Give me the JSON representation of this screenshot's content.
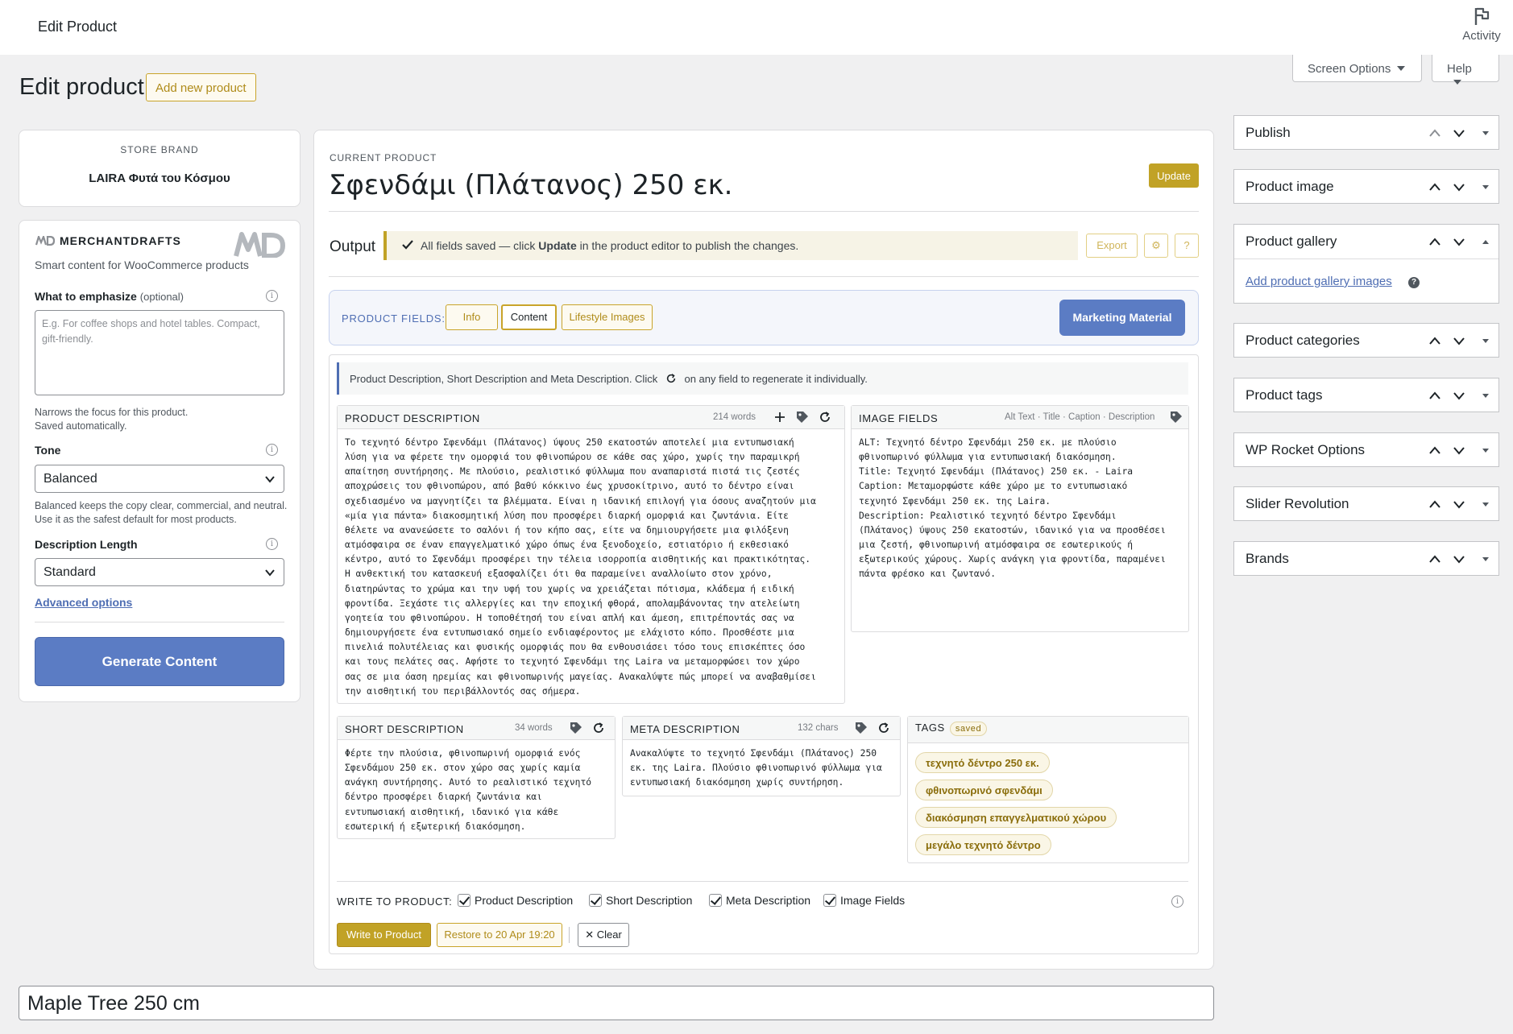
{
  "topbar": {
    "title": "Edit Product",
    "activity_label": "Activity"
  },
  "screen_options": {
    "screen_label": "Screen Options",
    "help_label": "Help"
  },
  "page": {
    "heading": "Edit product",
    "add_new_label": "Add new product"
  },
  "brand": {
    "label": "STORE BRAND",
    "name": "LAIRA Φυτά του Κόσμου"
  },
  "generator": {
    "logo_text": "MERCHANTDRAFTS",
    "subtitle": "Smart content for WooCommerce products",
    "emphasize_label": "What to emphasize",
    "emphasize_optional": "(optional)",
    "emphasize_placeholder": "E.g. For coffee shops and hotel tables. Compact, gift-friendly.",
    "emphasize_hint_1": "Narrows the focus for this product.",
    "emphasize_hint_2": "Saved automatically.",
    "tone_label": "Tone",
    "tone_value": "Balanced",
    "tone_hint": "Balanced keeps the copy clear, commercial, and neutral. Use it as the safest default for most products.",
    "length_label": "Description Length",
    "length_value": "Standard",
    "advanced_label": "Advanced options",
    "generate_label": "Generate Content",
    "brand_color": "#5b7cc4"
  },
  "main": {
    "current_label": "CURRENT PRODUCT",
    "product_title": "Σφενδάμι (Πλάτανος) 250 εκ.",
    "update_label": "Update",
    "output_label": "Output",
    "notice_pre": "All fields saved — click",
    "notice_bold": "Update",
    "notice_post": "in the product editor to publish the changes.",
    "export_label": "Export",
    "settings_icon_label": "⚙",
    "help_btn_label": "?",
    "fields_label": "PRODUCT FIELDS:",
    "tabs": [
      {
        "label": "Info"
      },
      {
        "label": "Content"
      },
      {
        "label": "Lifestyle Images"
      }
    ],
    "marketing_label": "Marketing Material",
    "intro_pre": "Product Description, Short Description and Meta Description. Click",
    "intro_post": "on any field to regenerate it individually.",
    "accent_color": "#c1a226"
  },
  "product_description": {
    "title": "PRODUCT DESCRIPTION",
    "words": "214 words",
    "text": "Το τεχνητό δέντρο Σφενδάμι (Πλάτανος) ύψους 250 εκατοστών αποτελεί μια εντυπωσιακή\nλύση για να φέρετε την ομορφιά του φθινοπώρου σε κάθε σας χώρο, χωρίς την παραμικρή\nαπαίτηση συντήρησης. Με πλούσιο, ρεαλιστικό φύλλωμα που αναπαριστά πιστά τις ζεστές\nαποχρώσεις του φθινοπώρου, από βαθύ κόκκινο έως χρυσοκίτρινο, αυτό το δέντρο είναι\nσχεδιασμένο να μαγνητίζει τα βλέμματα. Είναι η ιδανική επιλογή για όσους αναζητούν μια\n«μία για πάντα» διακοσμητική λύση που προσφέρει διαρκή ομορφιά και ζωντάνια. Είτε\nθέλετε να ανανεώσετε το σαλόνι ή τον κήπο σας, είτε να δημιουργήσετε μια φιλόξενη\nατμόσφαιρα σε έναν επαγγελματικό χώρο όπως ένα ξενοδοχείο, εστιατόριο ή εκθεσιακό\nκέντρο, αυτό το Σφενδάμι προσφέρει την τέλεια ισορροπία αισθητικής και πρακτικότητας.\nΗ ανθεκτική του κατασκευή εξασφαλίζει ότι θα παραμείνει αναλλοίωτο στον χρόνο,\nδιατηρώντας το χρώμα και την υφή του χωρίς να χρειάζεται πότισμα, κλάδεμα ή ειδική\nφροντίδα. Ξεχάστε τις αλλεργίες και την εποχική φθορά, απολαμβάνοντας την ατελείωτη\nγοητεία του φθινοπώρου. Η τοποθέτησή του είναι απλή και άμεση, επιτρέποντάς σας να\nδημιουργήσετε ένα εντυπωσιακό σημείο ενδιαφέροντος με ελάχιστο κόπο. Προσθέστε μια\nπινελιά πολυτέλειας και φυσικής ομορφιάς που θα ενθουσιάσει τόσο τους επισκέπτες όσο\nκαι τους πελάτες σας. Αφήστε το τεχνητό Σφενδάμι της Laira να μεταμορφώσει τον χώρο\nσας σε μια όαση ηρεμίας και φθινοπωρινής μαγείας. Ανακαλύψτε πώς μπορεί να αναβαθμίσει\nτην αισθητική του περιβάλλοντός σας σήμερα."
  },
  "image_fields": {
    "title": "IMAGE FIELDS",
    "meta": "Alt Text · Title · Caption · Description",
    "text": "ALT: Τεχνητό δέντρο Σφενδάμι 250 εκ. με πλούσιο\nφθινοπωρινό φύλλωμα για εντυπωσιακή διακόσμηση.\nTitle: Τεχνητό Σφενδάμι (Πλάτανος) 250 εκ. - Laira\nCaption: Μεταμορφώστε κάθε χώρο με το εντυπωσιακό\nτεχνητό Σφενδάμι 250 εκ. της Laira.\nDescription: Ρεαλιστικό τεχνητό δέντρο Σφενδάμι\n(Πλάτανος) ύψους 250 εκατοστών, ιδανικό για να προσθέσει\nμια ζεστή, φθινοπωρινή ατμόσφαιρα σε εσωτερικούς ή\nεξωτερικούς χώρους. Χωρίς ανάγκη για φροντίδα, παραμένει\nπάντα φρέσκο και ζωντανό."
  },
  "short_description": {
    "title": "SHORT DESCRIPTION",
    "words": "34 words",
    "text": "Φέρτε την πλούσια, φθινοπωρινή ομορφιά ενός\nΣφενδάμου 250 εκ. στον χώρο σας χωρίς καμία\nανάγκη συντήρησης. Αυτό το ρεαλιστικό τεχνητό\nδέντρο προσφέρει διαρκή ζωντάνια και\nεντυπωσιακή αισθητική, ιδανικό για κάθε\nεσωτερική ή εξωτερική διακόσμηση."
  },
  "meta_description": {
    "title": "META DESCRIPTION",
    "chars": "132 chars",
    "text": "Ανακαλύψτε το τεχνητό Σφενδάμι (Πλάτανος) 250\nεκ. της Laira. Πλούσιο φθινοπωρινό φύλλωμα για\nεντυπωσιακή διακόσμηση χωρίς συντήρηση."
  },
  "tags": {
    "title": "TAGS",
    "badge": "saved",
    "items": [
      "τεχνητό δέντρο 250 εκ.",
      "φθινοπωρινό σφενδάμι",
      "διακόσμηση επαγγελματικού χώρου",
      "μεγάλο τεχνητό δέντρο"
    ]
  },
  "write": {
    "label": "WRITE TO PRODUCT:",
    "options": [
      "Product Description",
      "Short Description",
      "Meta Description",
      "Image Fields"
    ],
    "write_btn": "Write to Product",
    "restore_btn": "Restore to 20 Apr 19:20",
    "clear_btn": "Clear"
  },
  "sidebar": {
    "boxes": [
      "Publish",
      "Product image",
      "Product gallery",
      "Product categories",
      "Product tags",
      "WP Rocket Options",
      "Slider Revolution",
      "Brands"
    ],
    "gallery_link": "Add product gallery images"
  },
  "bottom": {
    "title_value": "Maple Tree 250 cm"
  }
}
